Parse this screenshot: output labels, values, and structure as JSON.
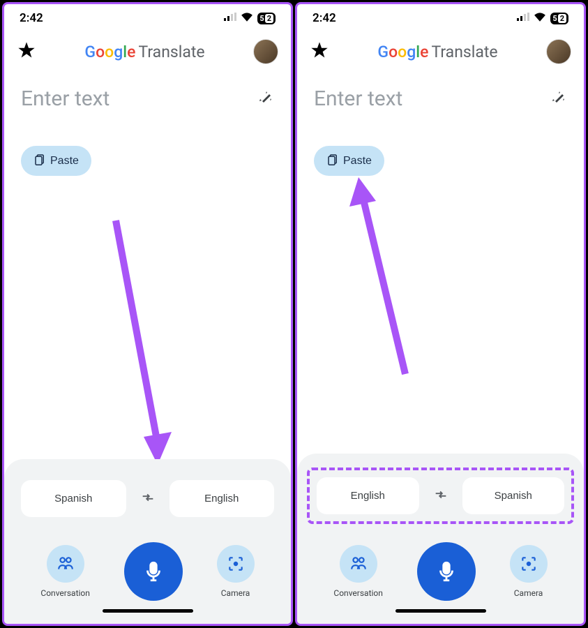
{
  "status": {
    "time": "2:42",
    "battery": "5",
    "battery_remainder": "2"
  },
  "header": {
    "logo_g": "G",
    "logo_o1": "o",
    "logo_o2": "o",
    "logo_g2": "g",
    "logo_l": "l",
    "logo_e": "e",
    "translate": "Translate"
  },
  "input": {
    "placeholder": "Enter text"
  },
  "paste": {
    "label": "Paste"
  },
  "screens": [
    {
      "source_lang": "Spanish",
      "target_lang": "English",
      "highlight_langs": false
    },
    {
      "source_lang": "English",
      "target_lang": "Spanish",
      "highlight_langs": true
    }
  ],
  "actions": {
    "conversation": "Conversation",
    "camera": "Camera"
  }
}
